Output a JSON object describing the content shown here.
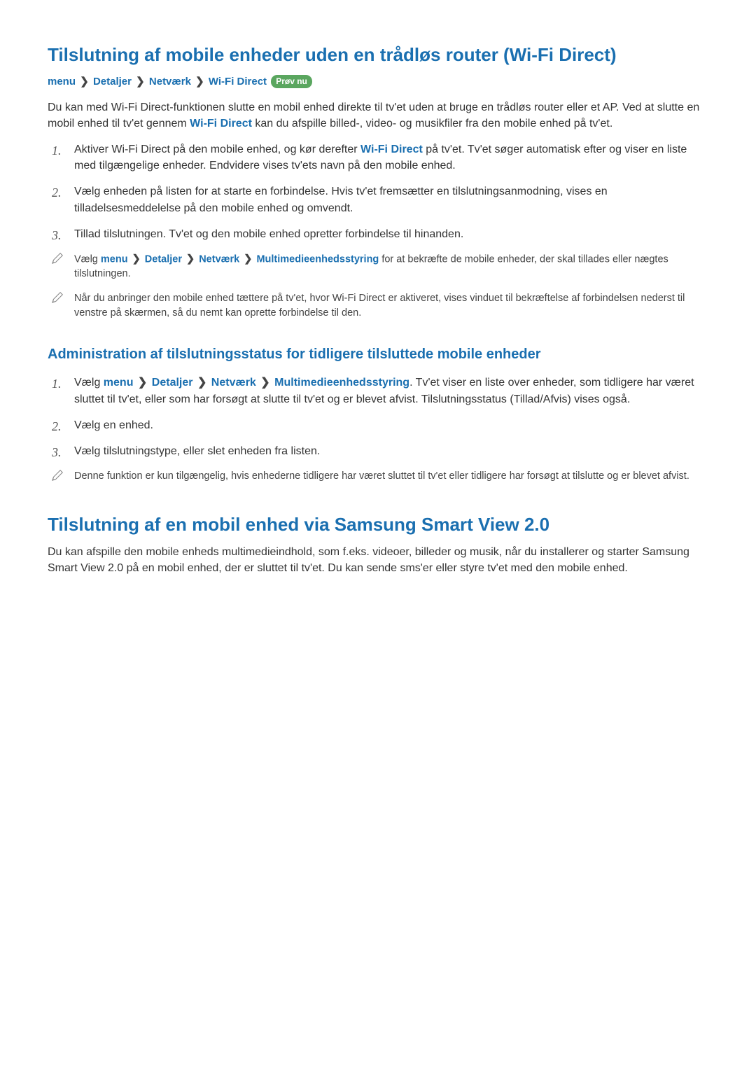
{
  "section1": {
    "title": "Tilslutning af mobile enheder uden en trådløs router (Wi-Fi Direct)",
    "breadcrumb": [
      "menu",
      "Detaljer",
      "Netværk",
      "Wi-Fi Direct"
    ],
    "badge": "Prøv nu",
    "intro_pre": "Du kan med Wi-Fi Direct-funktionen slutte en mobil enhed direkte til tv'et uden at bruge en trådløs router eller et AP. Ved at slutte en mobil enhed til tv'et gennem ",
    "intro_link": "Wi-Fi Direct",
    "intro_post": " kan du afspille billed-, video- og musikfiler fra den mobile enhed på tv'et.",
    "step1_pre": "Aktiver Wi-Fi Direct på den mobile enhed, og kør derefter ",
    "step1_link": "Wi-Fi Direct",
    "step1_post": " på tv'et. Tv'et søger automatisk efter og viser en liste med tilgængelige enheder. Endvidere vises tv'ets navn på den mobile enhed.",
    "step2": "Vælg enheden på listen for at starte en forbindelse. Hvis tv'et fremsætter en tilslutningsanmodning, vises en tilladelsesmeddelelse på den mobile enhed og omvendt.",
    "step3": "Tillad tilslutningen. Tv'et og den mobile enhed opretter forbindelse til hinanden.",
    "note1_pre": "Vælg ",
    "note1_bc": [
      "menu",
      "Detaljer",
      "Netværk",
      "Multimedieenhedsstyring"
    ],
    "note1_post": " for at bekræfte de mobile enheder, der skal tillades eller nægtes tilslutningen.",
    "note2": "Når du anbringer den mobile enhed tættere på tv'et, hvor Wi-Fi Direct er aktiveret, vises vinduet til bekræftelse af forbindelsen nederst til venstre på skærmen, så du nemt kan oprette forbindelse til den."
  },
  "section2": {
    "title": "Administration af tilslutningsstatus for tidligere tilsluttede mobile enheder",
    "step1_pre": "Vælg ",
    "step1_bc": [
      "menu",
      "Detaljer",
      "Netværk",
      "Multimedieenhedsstyring"
    ],
    "step1_post": ". Tv'et viser en liste over enheder, som tidligere har været sluttet til tv'et, eller som har forsøgt at slutte til tv'et og er blevet afvist. Tilslutningsstatus (Tillad/Afvis) vises også.",
    "step2": "Vælg en enhed.",
    "step3": "Vælg tilslutningstype, eller slet enheden fra listen.",
    "note": "Denne funktion er kun tilgængelig, hvis enhederne tidligere har været sluttet til tv'et eller tidligere har forsøgt at tilslutte og er blevet afvist."
  },
  "section3": {
    "title": "Tilslutning af en mobil enhed via Samsung Smart View 2.0",
    "body": "Du kan afspille den mobile enheds multimedieindhold, som f.eks. videoer, billeder og musik, når du installerer og starter Samsung Smart View 2.0 på en mobil enhed, der er sluttet til tv'et. Du kan sende sms'er eller styre tv'et med den mobile enhed."
  },
  "nums": {
    "n1": "1.",
    "n2": "2.",
    "n3": "3."
  }
}
